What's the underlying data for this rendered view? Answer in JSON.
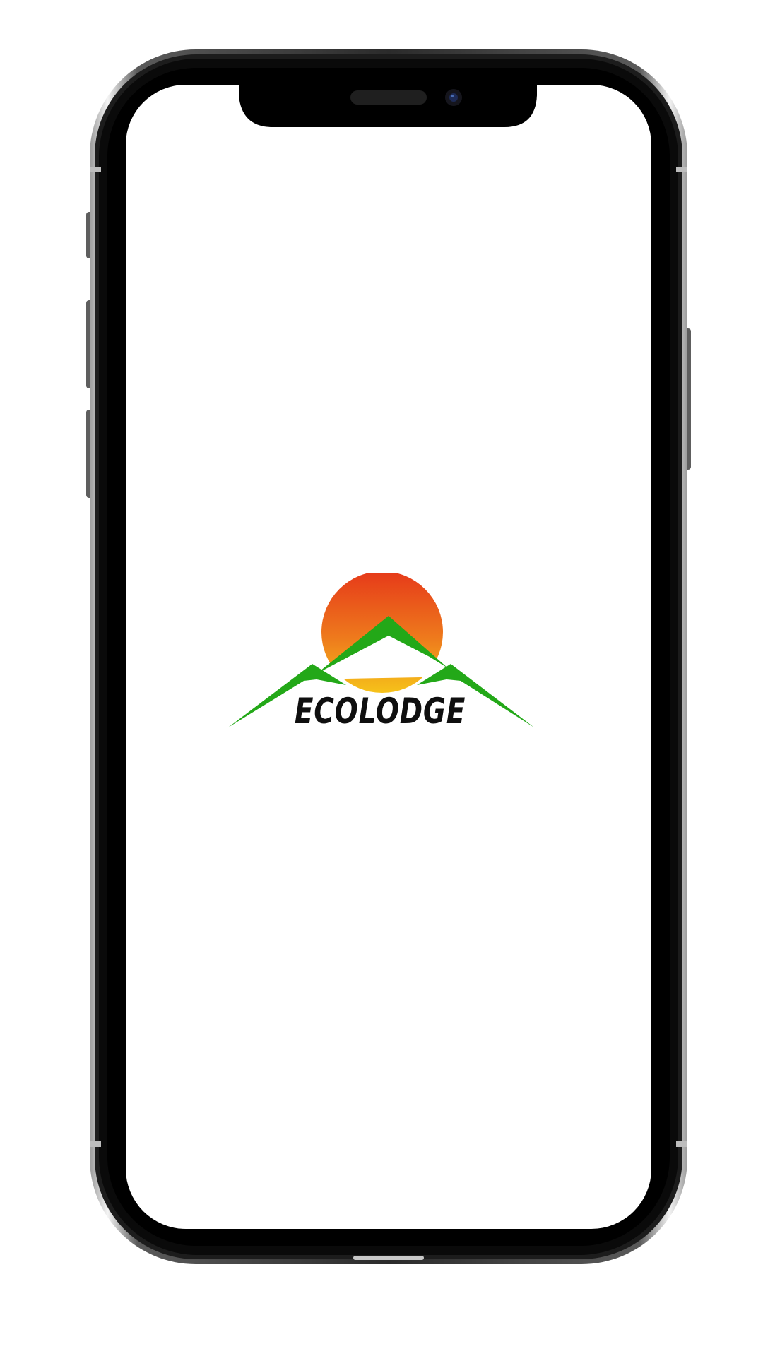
{
  "app": {
    "screen": "splash",
    "brand_name": "ECOLODGE"
  },
  "logo": {
    "icon_name": "sunrise-mountains-logo",
    "sun_gradient_top": "#e63a1a",
    "sun_gradient_bottom": "#f6c21a",
    "mountain_color": "#23a818",
    "text_color": "#0f0f0f"
  },
  "device": {
    "frame_color": "#0a0a0a",
    "background": "#ffffff"
  }
}
